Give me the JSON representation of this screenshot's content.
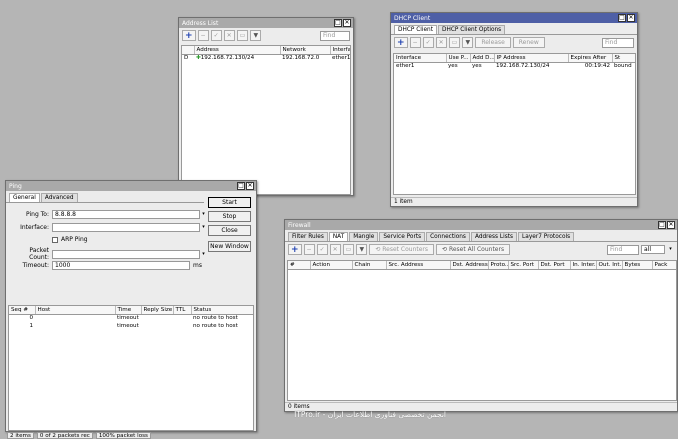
{
  "address_list": {
    "title": "Address List",
    "find_placeholder": "Find",
    "columns": [
      "",
      "Address",
      "Network",
      "Interfa"
    ],
    "rows": [
      {
        "flag": "D",
        "address": "192.168.72.130/24",
        "network": "192.168.72.0",
        "interface": "ether1"
      }
    ]
  },
  "dhcp_client": {
    "title": "DHCP Client",
    "tabs": [
      "DHCP Client",
      "DHCP Client Options"
    ],
    "release_label": "Release",
    "renew_label": "Renew",
    "find_placeholder": "Find",
    "columns": [
      "Interface",
      "Use P...",
      "Add D...",
      "IP Address",
      "Expires After",
      "St"
    ],
    "rows": [
      {
        "interface": "ether1",
        "use_peer": "yes",
        "add_default": "yes",
        "ip": "192.168.72.130/24",
        "expires": "00:19:42",
        "status": "bound"
      }
    ],
    "status": "1 item"
  },
  "ping": {
    "title": "Ping",
    "tabs": [
      "General",
      "Advanced"
    ],
    "ping_to_label": "Ping To:",
    "ping_to_value": "8.8.8.8",
    "interface_label": "Interface:",
    "arp_ping_label": "ARP Ping",
    "packet_count_label": "Packet Count:",
    "timeout_label": "Timeout:",
    "timeout_value": "1000",
    "timeout_unit": "ms",
    "buttons": {
      "start": "Start",
      "stop": "Stop",
      "close": "Close",
      "new_window": "New Window"
    },
    "columns": [
      "Seq #",
      "Host",
      "Time",
      "Reply Size",
      "TTL",
      "Status"
    ],
    "rows": [
      {
        "seq": "0",
        "host": "",
        "time": "timeout",
        "reply": "",
        "ttl": "",
        "status": "no route to host"
      },
      {
        "seq": "1",
        "host": "",
        "time": "timeout",
        "reply": "",
        "ttl": "",
        "status": "no route to host"
      }
    ]
  },
  "firewall": {
    "title": "Firewall",
    "tabs": [
      "Filter Rules",
      "NAT",
      "Mangle",
      "Service Ports",
      "Connections",
      "Address Lists",
      "Layer7 Protocols"
    ],
    "reset_counters": "Reset Counters",
    "reset_all_counters": "Reset All Counters",
    "find_placeholder": "Find",
    "filter_value": "all",
    "columns": [
      "#",
      "Action",
      "Chain",
      "Src. Address",
      "Dst. Address",
      "Proto...",
      "Src. Port",
      "Dst. Port",
      "In. Inter...",
      "Out. Int...",
      "Bytes",
      "Pack"
    ],
    "status": "0 items"
  },
  "bottom_strip": [
    "2 items",
    "0 of 2 packets rec",
    "100% packet loss"
  ],
  "watermark": "ITPro.ir - انجمن تخصصی فناوری اطلاعات ایران",
  "icons": {
    "add": "plus-icon",
    "remove": "minus-icon",
    "enable": "check-icon",
    "disable": "x-icon",
    "comment": "comment-icon",
    "filter": "filter-icon",
    "window_min": "restore-icon",
    "window_close": "close-icon"
  },
  "colors": {
    "active_title": "#4e5fa6",
    "inactive_title": "#a9a9a9",
    "desktop": "#b5b5b5",
    "add_blue": "#1d3fb0"
  }
}
